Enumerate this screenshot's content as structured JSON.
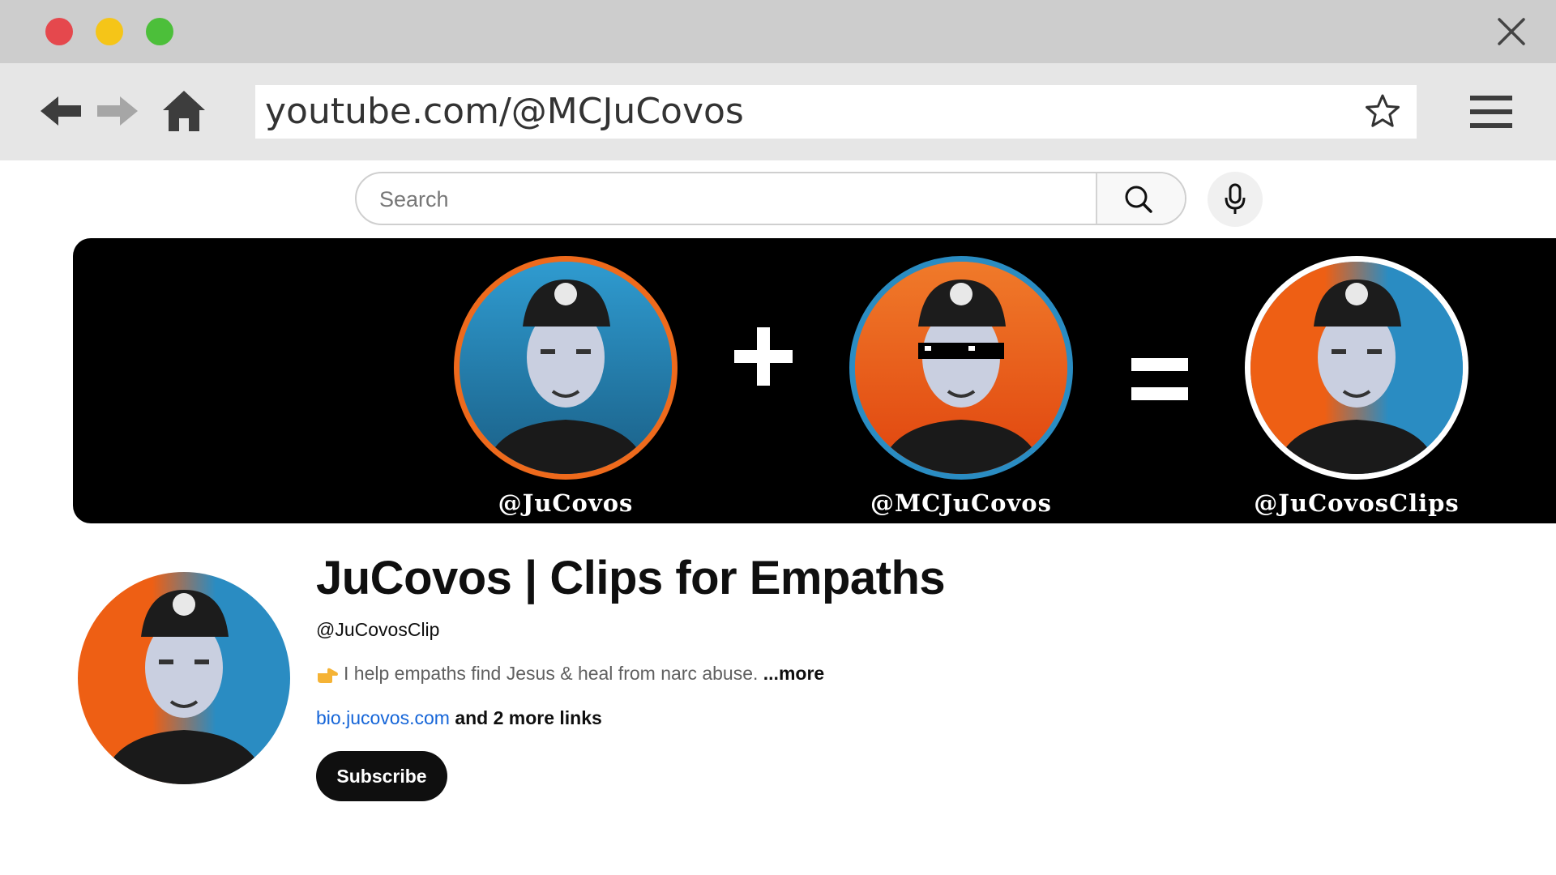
{
  "browser": {
    "url": "youtube.com/@MCJuCovos",
    "window_controls": [
      "close",
      "minimize",
      "maximize"
    ]
  },
  "search": {
    "placeholder": "Search"
  },
  "banner": {
    "avatars": [
      {
        "label": "@JuCovos",
        "ring": "#ee6a1c",
        "bg": "blue"
      },
      {
        "label": "@MCJuCovos",
        "ring": "#2a8cc2",
        "bg": "orange"
      },
      {
        "label": "@JuCovosClips",
        "ring": "#ffffff",
        "bg": "split"
      }
    ],
    "operators": [
      "+",
      "="
    ]
  },
  "channel": {
    "name": "JuCovos | Clips for Empaths",
    "handle": "@JuCovosClip",
    "description": "I help empaths find Jesus & heal from narc abuse.",
    "more_label": "...more",
    "link_text": "bio.jucovos.com",
    "more_links": "and 2 more links",
    "subscribe_label": "Subscribe"
  },
  "colors": {
    "accent_orange": "#ee6a1c",
    "accent_blue": "#2a8cc2",
    "link_blue": "#1565d8"
  }
}
